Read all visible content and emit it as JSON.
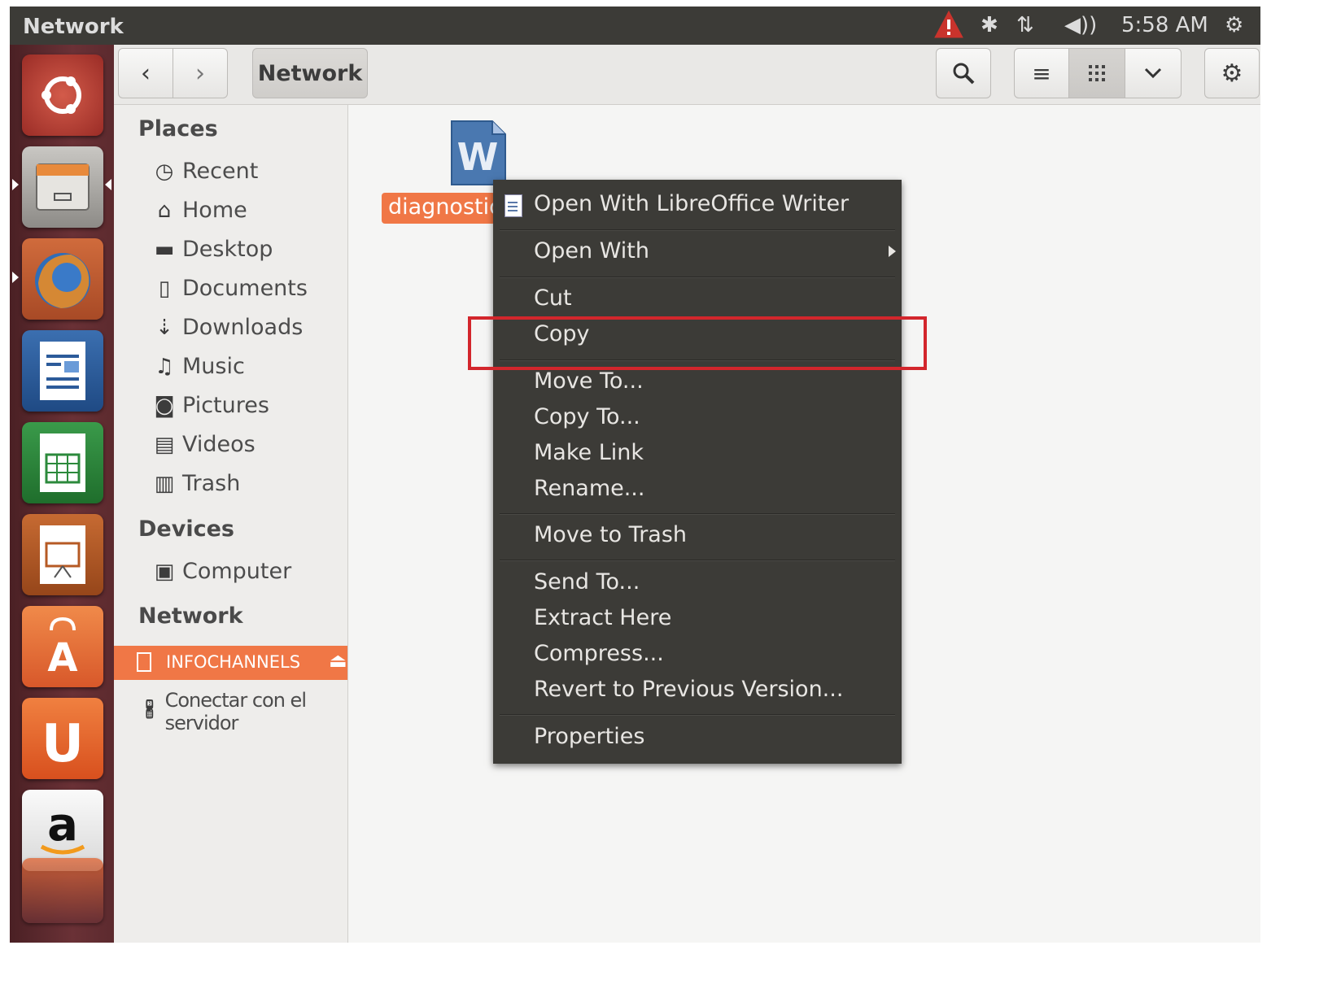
{
  "topbar": {
    "title": "Network",
    "clock": "5:58 AM",
    "icons": [
      "warning-icon",
      "bluetooth-icon",
      "network-icon",
      "volume-icon",
      "power-icon"
    ]
  },
  "launcher": {
    "items": [
      "ubuntu-dash-icon",
      "files-icon",
      "firefox-icon",
      "writer-icon",
      "calc-icon",
      "impress-icon",
      "software-center-icon",
      "ubuntu-one-icon",
      "amazon-icon",
      "updates-icon"
    ]
  },
  "toolbar": {
    "location": "Network",
    "back_icon": "chevron-left-icon",
    "forward_icon": "chevron-right-icon",
    "search_icon": "search-icon",
    "list_view_icon": "list-icon",
    "grid_view_icon": "grid-icon",
    "dropdown_icon": "chevron-down-icon",
    "settings_icon": "gear-icon"
  },
  "sidebar": {
    "places_header": "Places",
    "places": [
      "Recent",
      "Home",
      "Desktop",
      "Documents",
      "Downloads",
      "Music",
      "Pictures",
      "Videos",
      "Trash"
    ],
    "devices_header": "Devices",
    "devices": [
      "Computer"
    ],
    "network_header": "Network",
    "network_selected": "INFOCHANNELS",
    "connect": "Conectar con el servidor"
  },
  "file": {
    "name": "diagnostic",
    "icon": "word-document-icon"
  },
  "context_menu": {
    "open_with_writer": "Open With LibreOffice Writer",
    "open_with": "Open With",
    "cut": "Cut",
    "copy": "Copy",
    "move_to": "Move To...",
    "copy_to": "Copy To...",
    "make_link": "Make Link",
    "rename": "Rename...",
    "move_to_trash": "Move to Trash",
    "send_to": "Send To...",
    "extract_here": "Extract Here",
    "compress": "Compress...",
    "revert": "Revert to Previous Version...",
    "properties": "Properties"
  },
  "colors": {
    "accent": "#f07746",
    "panel": "#3c3b37",
    "highlight_box": "#d3262c"
  }
}
